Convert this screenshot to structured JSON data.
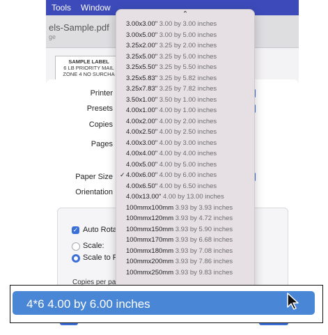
{
  "menubar": {
    "items": [
      "Tools",
      "Window"
    ]
  },
  "document": {
    "title": "els-Sample.pdf",
    "subtitle": "ge"
  },
  "preview": {
    "lines": [
      "SAMPLE LABEL",
      "6 LB PRIORITY MAIL",
      "ZONE 4 NO SURCHA"
    ]
  },
  "print_dialog": {
    "printer_label": "Printer",
    "presets_label": "Presets",
    "copies_label": "Copies",
    "pages_label": "Pages",
    "paper_size_label": "Paper Size",
    "orientation_label": "Orientation",
    "auto_rotate_label": "Auto Rotat",
    "scale_label": "Scale:",
    "scale_to_fit_label": "Scale to Fi",
    "copies_per_page_label": "Copies per pa"
  },
  "paper_size_menu": {
    "scroll_indicator": "⌃",
    "selected": "4.00x6.00\"",
    "items": [
      {
        "name": "3.00x3.00\"",
        "detail": "3.00 by 3.00 inches",
        "checked": false
      },
      {
        "name": "3.00x5.00\"",
        "detail": "3.00 by 5.00 inches",
        "checked": false
      },
      {
        "name": "3.25x2.00\"",
        "detail": "3.25 by 2.00 inches",
        "checked": false
      },
      {
        "name": "3.25x5.00\"",
        "detail": "3.25 by 5.00 inches",
        "checked": false
      },
      {
        "name": "3.25x5.50\"",
        "detail": "3.25 by 5.50 inches",
        "checked": false
      },
      {
        "name": "3.25x5.83\"",
        "detail": "3.25 by 5.82 inches",
        "checked": false
      },
      {
        "name": "3.25x7.83\"",
        "detail": "3.25 by 7.82 inches",
        "checked": false
      },
      {
        "name": "3.50x1.00\"",
        "detail": "3.50 by 1.00 inches",
        "checked": false
      },
      {
        "name": "4.00x1.00\"",
        "detail": "4.00 by 1.00 inches",
        "checked": false
      },
      {
        "name": "4.00x2.00\"",
        "detail": "4.00 by 2.00 inches",
        "checked": false
      },
      {
        "name": "4.00x2.50\"",
        "detail": "4.00 by 2.50 inches",
        "checked": false
      },
      {
        "name": "4.00x3.00\"",
        "detail": "4.00 by 3.00 inches",
        "checked": false
      },
      {
        "name": "4.00x4.00\"",
        "detail": "4.00 by 4.00 inches",
        "checked": false
      },
      {
        "name": "4.00x5.00\"",
        "detail": "4.00 by 5.00 inches",
        "checked": false
      },
      {
        "name": "4.00x6.00\"",
        "detail": "4.00 by 6.00 inches",
        "checked": true
      },
      {
        "name": "4.00x6.50\"",
        "detail": "4.00 by 6.50 inches",
        "checked": false
      },
      {
        "name": "4.00x13.00\"",
        "detail": "4.00 by 13.00 inches",
        "checked": false
      },
      {
        "name": "100mmx100mm",
        "detail": "3.93 by 3.93 inches",
        "checked": false
      },
      {
        "name": "100mmx120mm",
        "detail": "3.93 by 4.72 inches",
        "checked": false
      },
      {
        "name": "100mmx150mm",
        "detail": "3.93 by 5.90 inches",
        "checked": false
      },
      {
        "name": "100mmx170mm",
        "detail": "3.93 by 6.68 inches",
        "checked": false
      },
      {
        "name": "100mmx180mm",
        "detail": "3.93 by 7.08 inches",
        "checked": false
      },
      {
        "name": "100mmx200mm",
        "detail": "3.93 by 7.86 inches",
        "checked": false
      },
      {
        "name": "100mmx250mm",
        "detail": "3.93 by 9.83 inches",
        "checked": false
      }
    ]
  },
  "highlighted_item": {
    "text": "4*6 4.00 by 6.00 inches"
  },
  "colors": {
    "accent": "#3b6fd6",
    "highlight": "#4a86d6",
    "menubar": "#3c4bb9",
    "menu_bg": "#e6dfe3"
  },
  "icons": {
    "cursor": "arrow-cursor-icon",
    "checkmark": "checkmark-icon",
    "scroll_up": "chevron-up-icon"
  }
}
